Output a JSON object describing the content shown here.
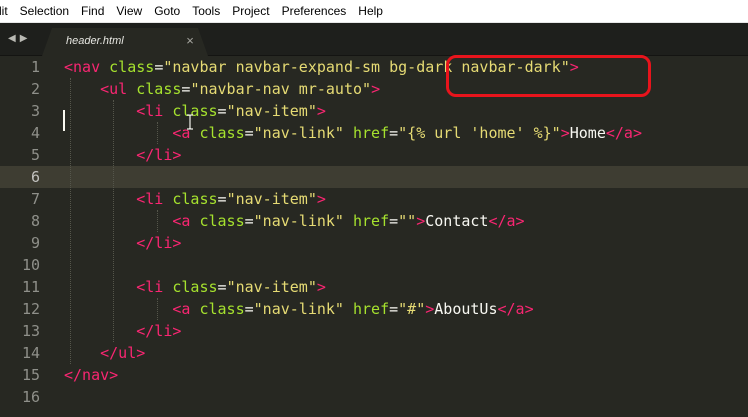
{
  "menu": {
    "items": [
      "lit",
      "Selection",
      "Find",
      "View",
      "Goto",
      "Tools",
      "Project",
      "Preferences",
      "Help"
    ]
  },
  "tabs": {
    "nav_left": "◀",
    "nav_right": "▶",
    "active_title": "header.html",
    "close_glyph": "×"
  },
  "editor": {
    "current_line": 6,
    "lines": [
      {
        "n": "1",
        "tokens": [
          [
            "t",
            "<nav"
          ],
          [
            "p",
            " "
          ],
          [
            "a",
            "class"
          ],
          [
            "p",
            "="
          ],
          [
            "s",
            "\"navbar navbar-expand-sm bg-dark navbar-dark\""
          ],
          [
            "t",
            ">"
          ]
        ]
      },
      {
        "n": "2",
        "tokens": [
          [
            "p",
            "    "
          ],
          [
            "t",
            "<ul"
          ],
          [
            "p",
            " "
          ],
          [
            "a",
            "class"
          ],
          [
            "p",
            "="
          ],
          [
            "s",
            "\"navbar-nav mr-auto\""
          ],
          [
            "t",
            ">"
          ]
        ]
      },
      {
        "n": "3",
        "tokens": [
          [
            "p",
            "        "
          ],
          [
            "t",
            "<li"
          ],
          [
            "p",
            " "
          ],
          [
            "a",
            "class"
          ],
          [
            "p",
            "="
          ],
          [
            "s",
            "\"nav-item\""
          ],
          [
            "t",
            ">"
          ]
        ]
      },
      {
        "n": "4",
        "tokens": [
          [
            "p",
            "            "
          ],
          [
            "t",
            "<a"
          ],
          [
            "p",
            " "
          ],
          [
            "a",
            "class"
          ],
          [
            "p",
            "="
          ],
          [
            "s",
            "\"nav-link\""
          ],
          [
            "p",
            " "
          ],
          [
            "a",
            "href"
          ],
          [
            "p",
            "="
          ],
          [
            "s",
            "\"{% url 'home' %}\""
          ],
          [
            "t",
            ">"
          ],
          [
            "p",
            "Home"
          ],
          [
            "t",
            "</a>"
          ]
        ]
      },
      {
        "n": "5",
        "tokens": [
          [
            "p",
            "        "
          ],
          [
            "t",
            "</li>"
          ]
        ]
      },
      {
        "n": "6",
        "tokens": []
      },
      {
        "n": "7",
        "tokens": [
          [
            "p",
            "        "
          ],
          [
            "t",
            "<li"
          ],
          [
            "p",
            " "
          ],
          [
            "a",
            "class"
          ],
          [
            "p",
            "="
          ],
          [
            "s",
            "\"nav-item\""
          ],
          [
            "t",
            ">"
          ]
        ]
      },
      {
        "n": "8",
        "tokens": [
          [
            "p",
            "            "
          ],
          [
            "t",
            "<a"
          ],
          [
            "p",
            " "
          ],
          [
            "a",
            "class"
          ],
          [
            "p",
            "="
          ],
          [
            "s",
            "\"nav-link\""
          ],
          [
            "p",
            " "
          ],
          [
            "a",
            "href"
          ],
          [
            "p",
            "="
          ],
          [
            "s",
            "\"\""
          ],
          [
            "t",
            ">"
          ],
          [
            "p",
            "Contact"
          ],
          [
            "t",
            "</a>"
          ]
        ]
      },
      {
        "n": "9",
        "tokens": [
          [
            "p",
            "        "
          ],
          [
            "t",
            "</li>"
          ]
        ]
      },
      {
        "n": "10",
        "tokens": []
      },
      {
        "n": "11",
        "tokens": [
          [
            "p",
            "        "
          ],
          [
            "t",
            "<li"
          ],
          [
            "p",
            " "
          ],
          [
            "a",
            "class"
          ],
          [
            "p",
            "="
          ],
          [
            "s",
            "\"nav-item\""
          ],
          [
            "t",
            ">"
          ]
        ]
      },
      {
        "n": "12",
        "tokens": [
          [
            "p",
            "            "
          ],
          [
            "t",
            "<a"
          ],
          [
            "p",
            " "
          ],
          [
            "a",
            "class"
          ],
          [
            "p",
            "="
          ],
          [
            "s",
            "\"nav-link\""
          ],
          [
            "p",
            " "
          ],
          [
            "a",
            "href"
          ],
          [
            "p",
            "="
          ],
          [
            "s",
            "\"#\""
          ],
          [
            "t",
            ">"
          ],
          [
            "p",
            "AboutUs"
          ],
          [
            "t",
            "</a>"
          ]
        ]
      },
      {
        "n": "13",
        "tokens": [
          [
            "p",
            "        "
          ],
          [
            "t",
            "</li>"
          ]
        ]
      },
      {
        "n": "14",
        "tokens": [
          [
            "p",
            "    "
          ],
          [
            "t",
            "</ul>"
          ]
        ]
      },
      {
        "n": "15",
        "tokens": [
          [
            "t",
            "</nav>"
          ]
        ]
      },
      {
        "n": "16",
        "tokens": []
      }
    ]
  },
  "annotation": {
    "color": "#e8141c",
    "target_text": "{% url 'home' %}"
  },
  "icons": {
    "mouse_cursor": "i-beam-cursor-icon"
  }
}
